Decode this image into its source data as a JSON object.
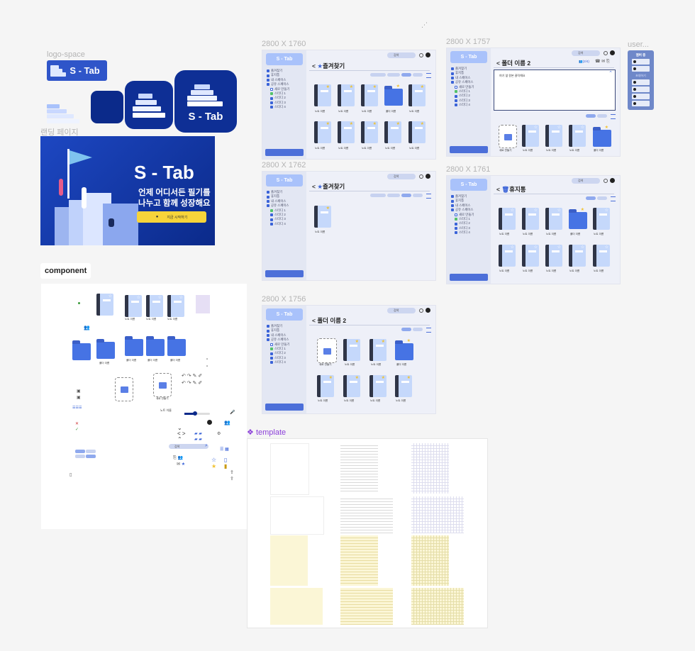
{
  "canvas_dots": "⋰",
  "labels": {
    "logo_space": "logo-space",
    "landing": "랜딩 페이지",
    "component": "component",
    "template": "template",
    "user": "user...",
    "frame1": "2800 X 1760",
    "frame2": "2800 X 1757",
    "frame3": "2800 X 1762",
    "frame4": "2800 X 1761",
    "frame5": "2800 X 1756"
  },
  "logo": {
    "text": "S - Tab"
  },
  "landing": {
    "title": "S - Tab",
    "line1": "언제 어디서든 필기를",
    "line2": "나누고 함께 성장해요",
    "cta": "지금 시작하기"
  },
  "app": {
    "brand": "S - Tab",
    "nav": [
      "즐겨찾기",
      "휴지통",
      "내 스페이스",
      "공유 스페이스",
      "새로 만들기",
      "스터디 1",
      "스터디 2",
      "스터디 3",
      "스터디 4"
    ],
    "search": "검색",
    "grid_label": "그리드",
    "list_label": "목록"
  },
  "frames": {
    "f1": {
      "title": "즐겨찾기"
    },
    "f2": {
      "title": "폴더 이름 2",
      "memo": "여기 옆 원본 클릭해요",
      "members": "(2/4)"
    },
    "f3": {
      "title": "즐겨찾기"
    },
    "f4": {
      "title": "휴지통"
    },
    "f5": {
      "title": "폴더 이름 2"
    }
  },
  "items": {
    "note": "노트 이름",
    "folder": "폴더 이름",
    "new": "새로 만들기",
    "meta": "2023.10.11"
  },
  "user_panel": {
    "title": "멤버 중",
    "sub": "초대하기",
    "rows": [
      "user",
      "user",
      "user",
      "user",
      "user"
    ]
  },
  "colors": {
    "accent": "#2f55c9",
    "nav_dark": "#0b2a8a",
    "yellow": "#f7d43a",
    "panel": "#eef0f8"
  }
}
